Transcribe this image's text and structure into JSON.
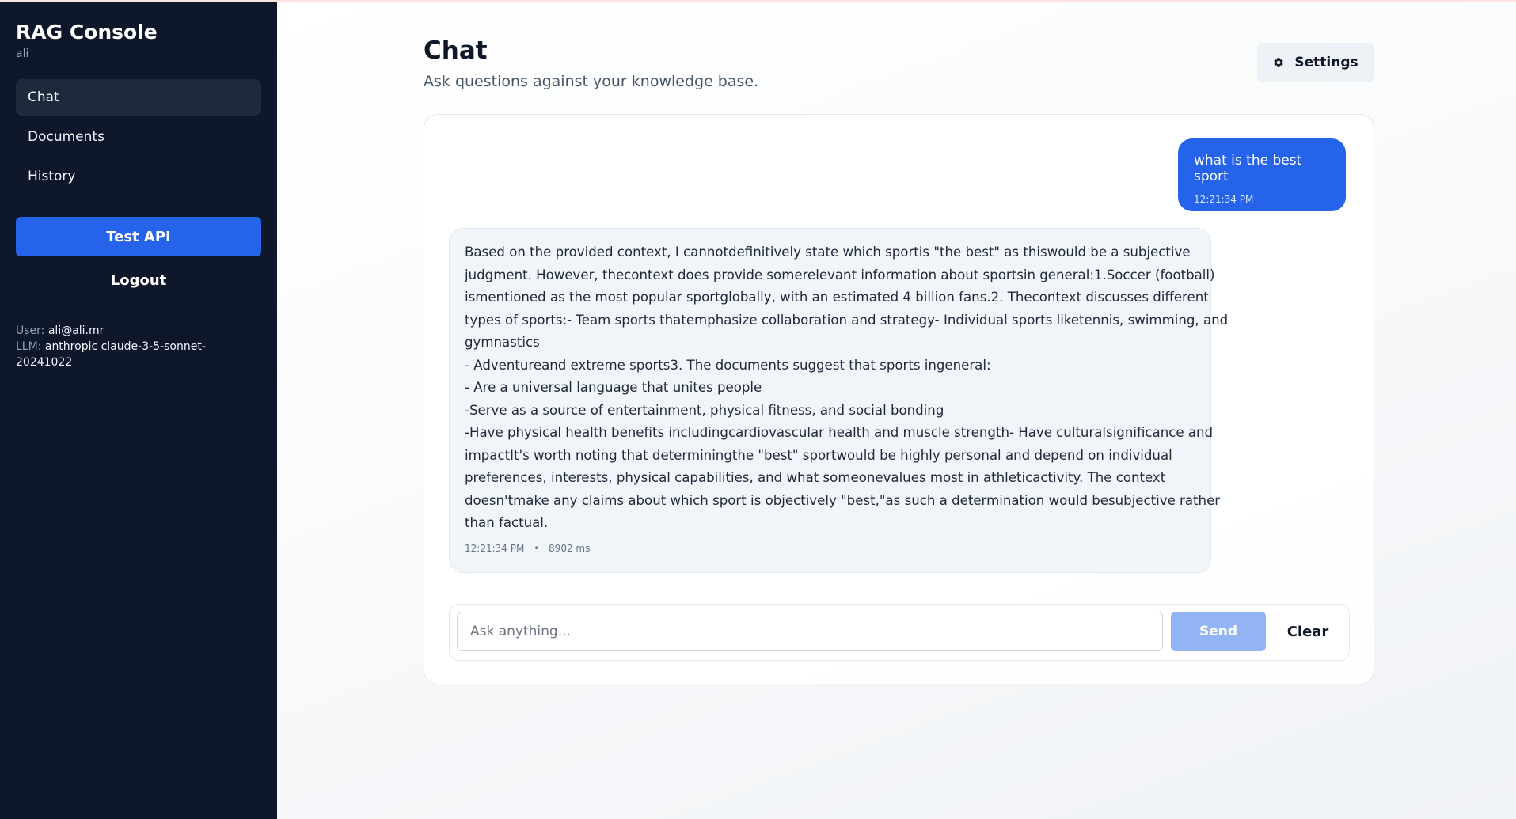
{
  "sidebar": {
    "title": "RAG Console",
    "subtitle": "ali",
    "nav": [
      {
        "label": "Chat",
        "active": true
      },
      {
        "label": "Documents",
        "active": false
      },
      {
        "label": "History",
        "active": false
      }
    ],
    "test_api_label": "Test API",
    "logout_label": "Logout",
    "user_key": "User:",
    "user_value": "ali@ali.mr",
    "llm_key": "LLM:",
    "llm_value": "anthropic claude-3-5-sonnet-20241022"
  },
  "header": {
    "title": "Chat",
    "subtitle": "Ask questions against your knowledge base.",
    "settings_label": "Settings",
    "settings_icon": "gear-icon"
  },
  "messages": {
    "user": {
      "text": "what is the best sport",
      "time": "12:21:34 PM"
    },
    "assistant": {
      "lines": [
        "Based on the provided context, I cannotdefinitively state which sportis \"the best\" as thiswould be a subjective",
        "judgment. However, thecontext does provide somerelevant information about sportsin general:1.Soccer (football)",
        "ismentioned as the most popular sportglobally, with an estimated 4 billion fans.2. Thecontext discusses different",
        "types of sports:- Team sports thatemphasize collaboration and strategy- Individual sports liketennis, swimming, and",
        "gymnastics",
        "- Adventureand extreme sports3. The documents suggest that sports ingeneral:",
        "- Are a universal language that unites people",
        "-Serve as a source of entertainment, physical fitness, and social bonding",
        "-Have physical health benefits includingcardiovascular health and muscle strength- Have culturalsignificance and",
        "impactIt's worth noting that determiningthe \"best\" sportwould be highly personal and depend on individual",
        "preferences, interests, physical capabilities, and what someonevalues most in athleticactivity. The context",
        "doesn'tmake any claims about which sport is objectively \"best,\"as such a determination would besubjective rather",
        "than factual."
      ],
      "time": "12:21:34 PM",
      "separator": "•",
      "latency": "8902 ms"
    }
  },
  "composer": {
    "placeholder": "Ask anything...",
    "value": "",
    "send_label": "Send",
    "clear_label": "Clear"
  },
  "colors": {
    "sidebar_bg": "#0f172a",
    "accent": "#2563eb",
    "send_disabled": "#93b4f4"
  }
}
